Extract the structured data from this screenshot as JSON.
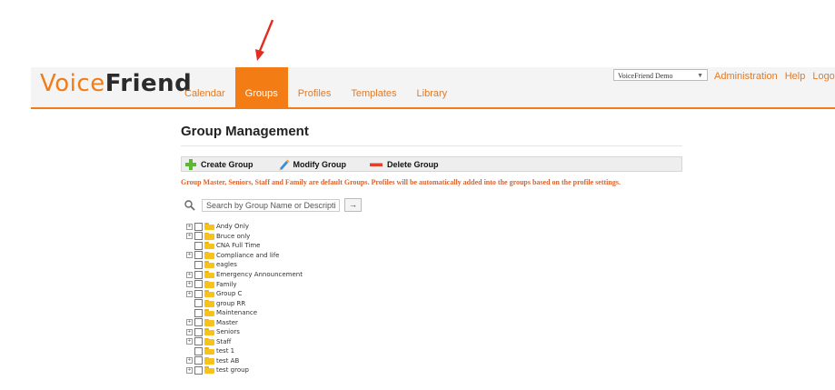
{
  "app": {
    "logo_part1": "Voice",
    "logo_part2": "Friend"
  },
  "nav": {
    "tabs": [
      {
        "label": "Calendar",
        "active": false
      },
      {
        "label": "Groups",
        "active": true
      },
      {
        "label": "Profiles",
        "active": false
      },
      {
        "label": "Templates",
        "active": false
      },
      {
        "label": "Library",
        "active": false
      }
    ]
  },
  "account": {
    "selected": "VoiceFriend Demo"
  },
  "top_links": {
    "administration": "Administration",
    "help": "Help",
    "logout": "Logout"
  },
  "page": {
    "title": "Group Management",
    "notice": "Group Master, Seniors, Staff and Family are default Groups. Profiles will be automatically added into the groups based on the profile settings."
  },
  "toolbar": {
    "create_label": "Create Group",
    "modify_label": "Modify Group",
    "delete_label": "Delete Group"
  },
  "search": {
    "placeholder": "Search by Group Name or Description",
    "go_glyph": "→"
  },
  "groups": [
    {
      "name": "Andy Only",
      "expandable": true
    },
    {
      "name": "Bruce only",
      "expandable": true
    },
    {
      "name": "CNA Full Time",
      "expandable": false
    },
    {
      "name": "Compliance and life",
      "expandable": true
    },
    {
      "name": "eagles",
      "expandable": false
    },
    {
      "name": "Emergency Announcement",
      "expandable": true
    },
    {
      "name": "Family",
      "expandable": true
    },
    {
      "name": "Group C",
      "expandable": true
    },
    {
      "name": "group RR",
      "expandable": false
    },
    {
      "name": "Maintenance",
      "expandable": false
    },
    {
      "name": "Master",
      "expandable": true
    },
    {
      "name": "Seniors",
      "expandable": true
    },
    {
      "name": "Staff",
      "expandable": true
    },
    {
      "name": "test 1",
      "expandable": false
    },
    {
      "name": "test AB",
      "expandable": true
    },
    {
      "name": "test group",
      "expandable": true
    }
  ],
  "colors": {
    "accent": "#f47c14",
    "annotation_arrow": "#e32b1f"
  }
}
